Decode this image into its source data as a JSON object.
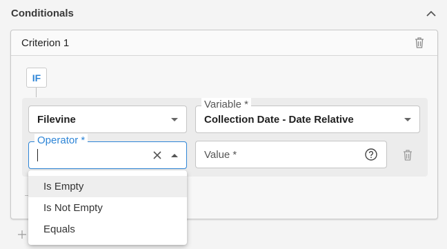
{
  "section": {
    "title": "Conditionals",
    "collapse_icon": "chevron-up-icon"
  },
  "criterion": {
    "title": "Criterion 1",
    "delete_icon": "trash-icon"
  },
  "if_badge": "IF",
  "fields": {
    "source": {
      "value": "Filevine"
    },
    "variable": {
      "label": "Variable *",
      "value": "Collection Date - Date Relative"
    },
    "operator": {
      "label": "Operator *",
      "value": ""
    },
    "value_field": {
      "label": "Value *"
    }
  },
  "operator_options": [
    "Is Empty",
    "Is Not Empty",
    "Equals"
  ],
  "highlighted_option": "Is Empty",
  "colors": {
    "accent": "#2c84d6",
    "border": "#c4c4c4",
    "background": "#f4f4f4"
  }
}
